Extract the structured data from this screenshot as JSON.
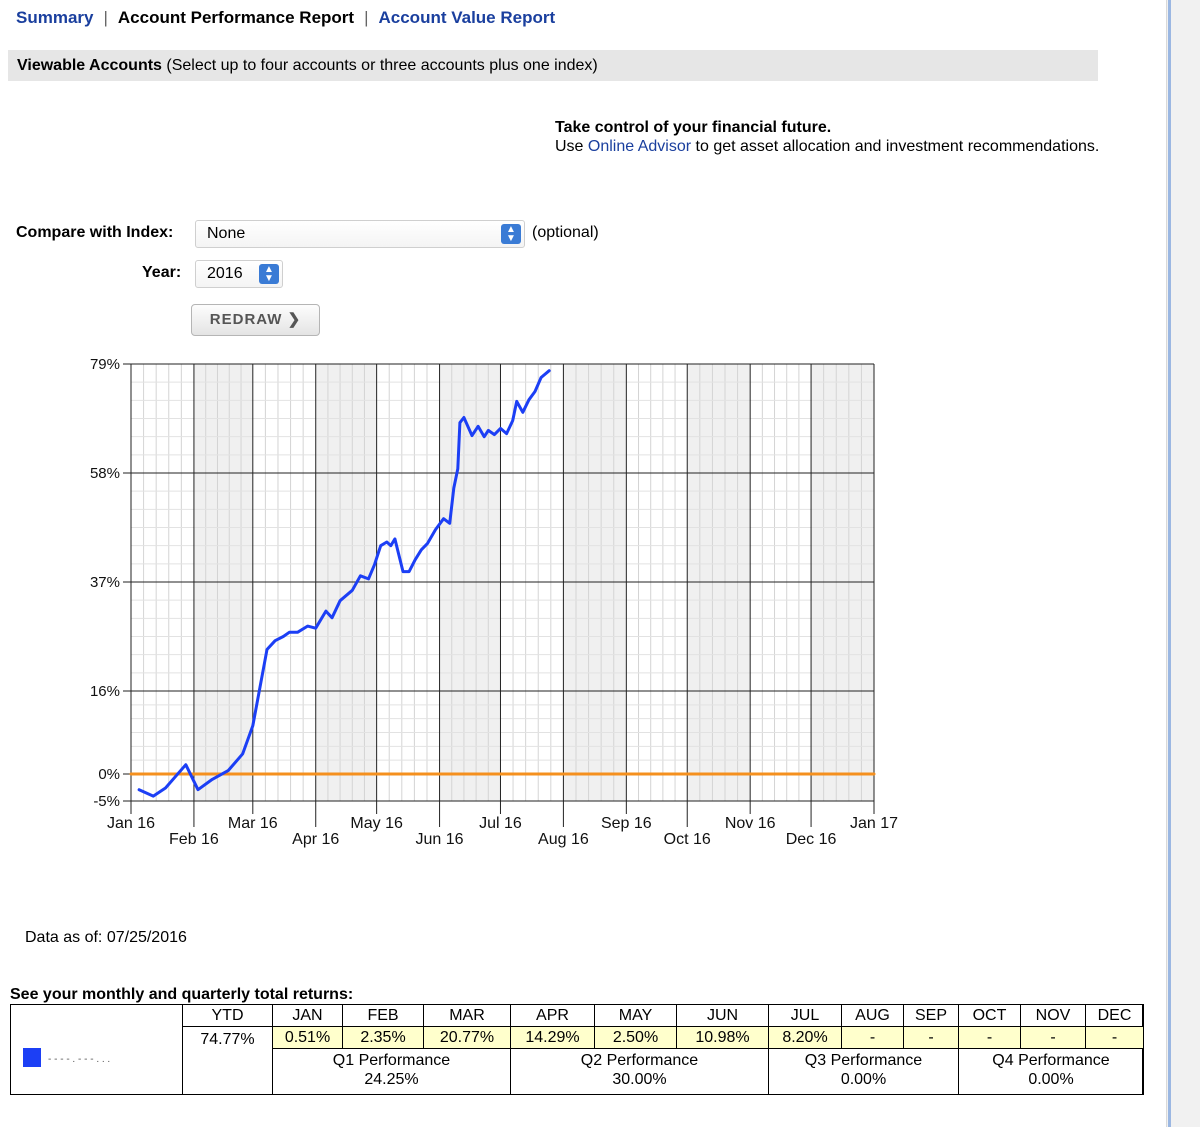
{
  "nav": {
    "summary": "Summary",
    "separator": "|",
    "account_performance": "Account Performance Report",
    "account_value": "Account Value Report"
  },
  "viewable": {
    "title": "Viewable Accounts",
    "note": "(Select up to four accounts or three accounts plus one index)"
  },
  "promo": {
    "line1": "Take control of your financial future.",
    "line2_pre": "Use ",
    "line2_link": "Online Advisor",
    "line2_post": " to get asset allocation and investment recommendations."
  },
  "controls": {
    "compare_label": "Compare with Index:",
    "index_value": "None",
    "optional": "(optional)",
    "year_label": "Year:",
    "year_value": "2016",
    "redraw": "REDRAW"
  },
  "chart_data": {
    "type": "line",
    "y_ticks": [
      "79%",
      "58%",
      "37%",
      "16%",
      "0%",
      "-5%"
    ],
    "y_tick_values": [
      79,
      58,
      37,
      16,
      0,
      -5
    ],
    "ylim": [
      -5,
      79
    ],
    "x_ticks": [
      "Jan 16",
      "Feb 16",
      "Mar 16",
      "Apr 16",
      "May 16",
      "Jun 16",
      "Jul 16",
      "Aug 16",
      "Sep 16",
      "Oct 16",
      "Nov 16",
      "Dec 16",
      "Jan 17"
    ],
    "x_domain": [
      "2016-01-01",
      "2017-01-01"
    ],
    "grid": true,
    "series": [
      {
        "color": "#1c3ff5",
        "points": [
          [
            "2016-01-05",
            -2.9
          ],
          [
            "2016-01-12",
            -4.1
          ],
          [
            "2016-01-18",
            -2.6
          ],
          [
            "2016-01-28",
            1.8
          ],
          [
            "2016-02-03",
            -2.9
          ],
          [
            "2016-02-10",
            -1.0
          ],
          [
            "2016-02-18",
            0.7
          ],
          [
            "2016-02-25",
            3.9
          ],
          [
            "2016-03-01",
            9.3
          ],
          [
            "2016-03-08",
            24.0
          ],
          [
            "2016-03-12",
            25.7
          ],
          [
            "2016-03-16",
            26.5
          ],
          [
            "2016-03-19",
            27.3
          ],
          [
            "2016-03-23",
            27.3
          ],
          [
            "2016-03-28",
            28.5
          ],
          [
            "2016-04-01",
            28.1
          ],
          [
            "2016-04-06",
            31.4
          ],
          [
            "2016-04-09",
            30.1
          ],
          [
            "2016-04-13",
            33.4
          ],
          [
            "2016-04-19",
            35.4
          ],
          [
            "2016-04-23",
            38.2
          ],
          [
            "2016-04-27",
            37.6
          ],
          [
            "2016-04-30",
            40.4
          ],
          [
            "2016-05-03",
            44.0
          ],
          [
            "2016-05-06",
            44.7
          ],
          [
            "2016-05-08",
            44.0
          ],
          [
            "2016-05-10",
            45.3
          ],
          [
            "2016-05-12",
            42.1
          ],
          [
            "2016-05-14",
            39.0
          ],
          [
            "2016-05-17",
            39.0
          ],
          [
            "2016-05-20",
            41.3
          ],
          [
            "2016-05-23",
            43.2
          ],
          [
            "2016-05-26",
            44.4
          ],
          [
            "2016-05-30",
            47.1
          ],
          [
            "2016-06-03",
            49.2
          ],
          [
            "2016-06-06",
            48.3
          ],
          [
            "2016-06-08",
            55.1
          ],
          [
            "2016-06-10",
            58.8
          ],
          [
            "2016-06-11",
            67.7
          ],
          [
            "2016-06-13",
            68.7
          ],
          [
            "2016-06-17",
            65.2
          ],
          [
            "2016-06-20",
            67.0
          ],
          [
            "2016-06-23",
            65.0
          ],
          [
            "2016-06-25",
            66.2
          ],
          [
            "2016-06-28",
            65.4
          ],
          [
            "2016-07-01",
            66.6
          ],
          [
            "2016-07-04",
            65.6
          ],
          [
            "2016-07-07",
            68.1
          ],
          [
            "2016-07-09",
            71.8
          ],
          [
            "2016-07-12",
            69.7
          ],
          [
            "2016-07-15",
            72.1
          ],
          [
            "2016-07-18",
            73.7
          ],
          [
            "2016-07-21",
            76.4
          ],
          [
            "2016-07-25",
            77.7
          ]
        ]
      },
      {
        "color": "#f5901e",
        "points": [
          [
            "2016-01-01",
            0
          ],
          [
            "2017-01-01",
            0
          ]
        ]
      }
    ]
  },
  "data_as_of": "Data as of: 07/25/2016",
  "returns": {
    "title": "See your monthly and quarterly total returns:",
    "ytd_header": "YTD",
    "ytd_value": "74.77%",
    "account_label": "- - - - . - - - . . .",
    "account_color": "#1c3ff5",
    "months": [
      {
        "label": "JAN",
        "value": "0.51%"
      },
      {
        "label": "FEB",
        "value": "2.35%"
      },
      {
        "label": "MAR",
        "value": "20.77%"
      },
      {
        "label": "APR",
        "value": "14.29%"
      },
      {
        "label": "MAY",
        "value": "2.50%"
      },
      {
        "label": "JUN",
        "value": "10.98%"
      },
      {
        "label": "JUL",
        "value": "8.20%"
      },
      {
        "label": "AUG",
        "value": "-"
      },
      {
        "label": "SEP",
        "value": "-"
      },
      {
        "label": "OCT",
        "value": "-"
      },
      {
        "label": "NOV",
        "value": "-"
      },
      {
        "label": "DEC",
        "value": "-"
      }
    ],
    "quarters": [
      {
        "label": "Q1 Performance",
        "value": "24.25%"
      },
      {
        "label": "Q2 Performance",
        "value": "30.00%"
      },
      {
        "label": "Q3 Performance",
        "value": "0.00%"
      },
      {
        "label": "Q4 Performance",
        "value": "0.00%"
      }
    ]
  }
}
